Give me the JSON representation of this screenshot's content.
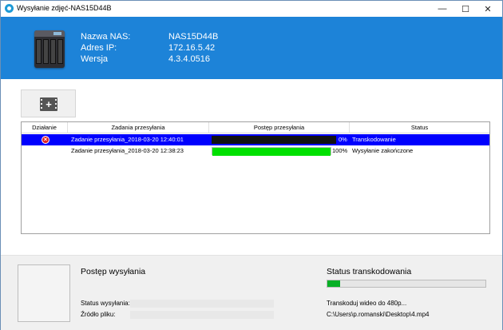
{
  "window": {
    "title": "Wysyłanie zdjęć-NAS15D44B",
    "minimize": "—",
    "maximize": "☐",
    "close": "✕"
  },
  "header": {
    "nas_name_label": "Nazwa NAS:",
    "nas_name_value": "NAS15D44B",
    "ip_label": "Adres IP:",
    "ip_value": "172.16.5.42",
    "version_label": "Wersja",
    "version_value": "4.3.4.0516",
    "device_icon": "nas-device-icon"
  },
  "toolbar": {
    "add_video_icon": "film-plus-icon"
  },
  "table": {
    "columns": [
      "Działanie",
      "Zadania przesyłania",
      "Postęp przesyłania",
      "Status"
    ],
    "rows": [
      {
        "action_icon": "error-icon",
        "task": "Zadanie przesyłania_2018-03-20 12:40:01",
        "progress": 0,
        "progress_text": "0%",
        "status": "Transkodowanie",
        "selected": true
      },
      {
        "action_icon": "",
        "task": "Zadanie przesyłania_2018-03-20 12:38:23",
        "progress": 100,
        "progress_text": "100%",
        "status": "Wysyłanie zakończone",
        "selected": false
      }
    ]
  },
  "bottom": {
    "upload_progress_title": "Postęp wysyłania",
    "upload_status_label": "Status wysyłania:",
    "source_file_label": "Źródło pliku:",
    "transcode_status_title": "Status transkodowania",
    "transcode_progress": 0.08,
    "transcode_task": "Transkoduj wideo do 480p...",
    "transcode_file": "C:\\Users\\p.romanski\\Desktop\\4.mp4"
  },
  "colors": {
    "header_bg": "#1d83d8",
    "selected_row": "#0000fe",
    "progress_green": "#00e000"
  }
}
